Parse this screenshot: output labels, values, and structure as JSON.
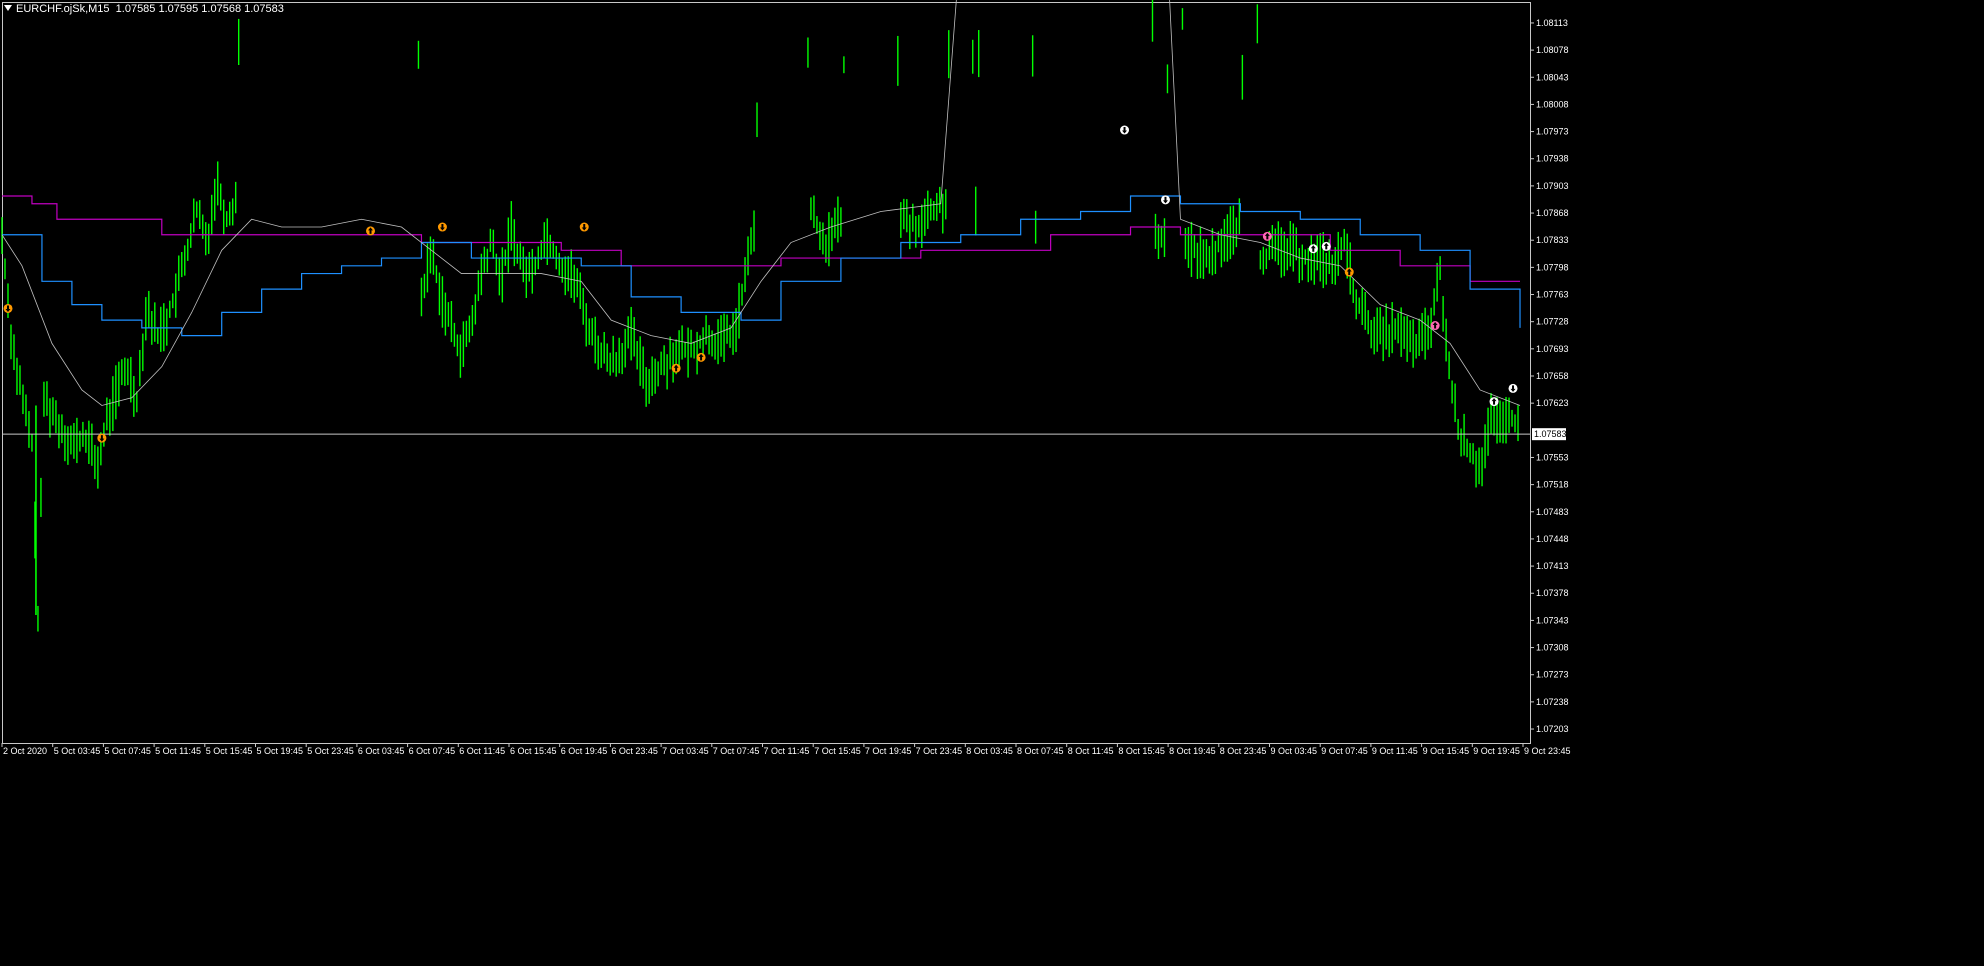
{
  "header": {
    "symbol_tf": "EURCHF.ojSk,M15",
    "ohlc": "1.07585 1.07595 1.07568 1.07583"
  },
  "colors": {
    "background": "#000000",
    "frame": "#c8c8c8",
    "bars": "#00ff00",
    "ma_slow": "#c000c0",
    "ma_mid": "#1e90ff",
    "ma_fast": "#c0c0c0",
    "price_line": "#c8c8c8",
    "signal_orange": "#ff9900",
    "signal_white": "#ffffff",
    "signal_pink": "#ff69b4"
  },
  "chart_data": {
    "type": "line",
    "title": "EURCHF.ojSk,M15",
    "ylim": [
      1.07185,
      1.0814
    ],
    "y_ticks": [
      "1.08113",
      "1.08078",
      "1.08043",
      "1.08008",
      "1.07973",
      "1.07938",
      "1.07903",
      "1.07868",
      "1.07833",
      "1.07798",
      "1.07763",
      "1.07728",
      "1.07693",
      "1.07658",
      "1.07623",
      "1.07553",
      "1.07518",
      "1.07483",
      "1.07448",
      "1.07413",
      "1.07378",
      "1.07343",
      "1.07308",
      "1.07273",
      "1.07238",
      "1.07203"
    ],
    "x_ticks": [
      "2 Oct 2020",
      "5 Oct 03:45",
      "5 Oct 07:45",
      "5 Oct 11:45",
      "5 Oct 15:45",
      "5 Oct 19:45",
      "5 Oct 23:45",
      "6 Oct 03:45",
      "6 Oct 07:45",
      "6 Oct 11:45",
      "6 Oct 15:45",
      "6 Oct 19:45",
      "6 Oct 23:45",
      "7 Oct 03:45",
      "7 Oct 07:45",
      "7 Oct 11:45",
      "7 Oct 15:45",
      "7 Oct 19:45",
      "7 Oct 23:45",
      "8 Oct 03:45",
      "8 Oct 07:45",
      "8 Oct 11:45",
      "8 Oct 15:45",
      "8 Oct 19:45",
      "8 Oct 23:45",
      "9 Oct 03:45",
      "9 Oct 07:45",
      "9 Oct 11:45",
      "9 Oct 15:45",
      "9 Oct 19:45",
      "9 Oct 23:45"
    ],
    "current_price": 1.07583,
    "current_price_label": "1.07583",
    "price_series": [
      [
        0,
        1.0784
      ],
      [
        10,
        1.077
      ],
      [
        20,
        1.0763
      ],
      [
        30,
        1.0757
      ],
      [
        36,
        1.0735
      ],
      [
        42,
        1.0763
      ],
      [
        55,
        1.076
      ],
      [
        70,
        1.0757
      ],
      [
        85,
        1.0758
      ],
      [
        95,
        1.0754
      ],
      [
        105,
        1.076
      ],
      [
        115,
        1.0764
      ],
      [
        125,
        1.0767
      ],
      [
        135,
        1.0763
      ],
      [
        145,
        1.0775
      ],
      [
        155,
        1.0771
      ],
      [
        165,
        1.0773
      ],
      [
        175,
        1.0777
      ],
      [
        185,
        1.0782
      ],
      [
        195,
        1.0787
      ],
      [
        205,
        1.0783
      ],
      [
        215,
        1.0791
      ],
      [
        225,
        1.0786
      ],
      [
        235,
        1.0789
      ],
      [
        245,
        1.0891
      ],
      [
        255,
        1.0886
      ],
      [
        265,
        1.0884
      ],
      [
        275,
        1.088
      ],
      [
        285,
        1.0882
      ],
      [
        295,
        1.088
      ],
      [
        305,
        1.0884
      ],
      [
        315,
        1.0883
      ],
      [
        325,
        1.0885
      ],
      [
        340,
        1.0885
      ],
      [
        355,
        1.0883
      ],
      [
        370,
        1.0882
      ],
      [
        385,
        1.0885
      ],
      [
        400,
        1.0884
      ],
      [
        410,
        1.088
      ],
      [
        420,
        1.0776
      ],
      [
        430,
        1.0782
      ],
      [
        440,
        1.0776
      ],
      [
        450,
        1.0772
      ],
      [
        460,
        1.0769
      ],
      [
        470,
        1.0772
      ],
      [
        480,
        1.0779
      ],
      [
        490,
        1.0783
      ],
      [
        500,
        1.0778
      ],
      [
        510,
        1.0785
      ],
      [
        520,
        1.078
      ],
      [
        530,
        1.0779
      ],
      [
        545,
        1.0784
      ],
      [
        560,
        1.078
      ],
      [
        575,
        1.0778
      ],
      [
        585,
        1.0773
      ],
      [
        595,
        1.077
      ],
      [
        605,
        1.0768
      ],
      [
        615,
        1.0768
      ],
      [
        630,
        1.0771
      ],
      [
        645,
        1.0765
      ],
      [
        660,
        1.0767
      ],
      [
        675,
        1.0769
      ],
      [
        690,
        1.0769
      ],
      [
        705,
        1.0771
      ],
      [
        720,
        1.077
      ],
      [
        735,
        1.0772
      ],
      [
        745,
        1.0779
      ],
      [
        755,
        1.0787
      ],
      [
        765,
        1.0891
      ],
      [
        775,
        1.0889
      ],
      [
        785,
        1.0891
      ],
      [
        795,
        1.0891
      ],
      [
        810,
        1.0787
      ],
      [
        825,
        1.0783
      ],
      [
        840,
        1.0786
      ],
      [
        855,
        1.0886
      ],
      [
        870,
        1.0887
      ],
      [
        885,
        1.0888
      ],
      [
        900,
        1.0786
      ],
      [
        915,
        1.0785
      ],
      [
        930,
        1.0787
      ],
      [
        945,
        1.0788
      ],
      [
        960,
        1.0886
      ],
      [
        975,
        1.0787
      ],
      [
        990,
        1.0888
      ],
      [
        1005,
        1.0889
      ],
      [
        1020,
        1.089
      ],
      [
        1035,
        1.0786
      ],
      [
        1045,
        1.0887
      ],
      [
        1055,
        1.0892
      ],
      [
        1065,
        1.0889
      ],
      [
        1075,
        1.0886
      ],
      [
        1085,
        1.0895
      ],
      [
        1095,
        1.0898
      ],
      [
        1105,
        1.0897
      ],
      [
        1115,
        1.0899
      ],
      [
        1125,
        1.0895
      ],
      [
        1135,
        1.0888
      ],
      [
        1145,
        1.0881
      ],
      [
        1155,
        1.0783
      ],
      [
        1165,
        1.0784
      ],
      [
        1175,
        1.0882
      ],
      [
        1185,
        1.0782
      ],
      [
        1195,
        1.0782
      ],
      [
        1210,
        1.0781
      ],
      [
        1225,
        1.0784
      ],
      [
        1240,
        1.0785
      ],
      [
        1250,
        1.0885
      ],
      [
        1260,
        1.0781
      ],
      [
        1275,
        1.0782
      ],
      [
        1290,
        1.0782
      ],
      [
        1305,
        1.0781
      ],
      [
        1320,
        1.0781
      ],
      [
        1335,
        1.078
      ],
      [
        1345,
        1.0783
      ],
      [
        1355,
        1.0776
      ],
      [
        1365,
        1.0773
      ],
      [
        1380,
        1.0771
      ],
      [
        1395,
        1.0772
      ],
      [
        1410,
        1.077
      ],
      [
        1420,
        1.077
      ],
      [
        1430,
        1.0772
      ],
      [
        1440,
        1.0779
      ],
      [
        1450,
        1.0765
      ],
      [
        1460,
        1.0758
      ],
      [
        1470,
        1.0756
      ],
      [
        1480,
        1.0754
      ],
      [
        1490,
        1.076
      ],
      [
        1500,
        1.0759
      ],
      [
        1510,
        1.0761
      ],
      [
        1520,
        1.0758
      ]
    ],
    "series": [
      {
        "values": [
          [
            0,
            1.0789
          ],
          [
            30,
            1.0788
          ],
          [
            55,
            1.0786
          ],
          [
            110,
            1.0786
          ],
          [
            160,
            1.0784
          ],
          [
            300,
            1.0784
          ],
          [
            420,
            1.0783
          ],
          [
            560,
            1.0782
          ],
          [
            620,
            1.078
          ],
          [
            750,
            1.078
          ],
          [
            780,
            1.0781
          ],
          [
            920,
            1.0782
          ],
          [
            1050,
            1.0784
          ],
          [
            1130,
            1.0785
          ],
          [
            1180,
            1.0784
          ],
          [
            1250,
            1.0784
          ],
          [
            1330,
            1.0782
          ],
          [
            1400,
            1.078
          ],
          [
            1470,
            1.0778
          ],
          [
            1520,
            1.0778
          ]
        ]
      },
      {
        "values": [
          [
            0,
            1.0784
          ],
          [
            40,
            1.0778
          ],
          [
            70,
            1.0775
          ],
          [
            100,
            1.0773
          ],
          [
            140,
            1.0772
          ],
          [
            180,
            1.0771
          ],
          [
            220,
            1.0774
          ],
          [
            260,
            1.0777
          ],
          [
            300,
            1.0779
          ],
          [
            340,
            1.078
          ],
          [
            380,
            1.0781
          ],
          [
            420,
            1.0783
          ],
          [
            470,
            1.0781
          ],
          [
            530,
            1.0781
          ],
          [
            580,
            1.078
          ],
          [
            630,
            1.0776
          ],
          [
            680,
            1.0774
          ],
          [
            740,
            1.0773
          ],
          [
            780,
            1.0778
          ],
          [
            840,
            1.0781
          ],
          [
            900,
            1.0783
          ],
          [
            960,
            1.0784
          ],
          [
            1020,
            1.0786
          ],
          [
            1080,
            1.0787
          ],
          [
            1130,
            1.0789
          ],
          [
            1180,
            1.0788
          ],
          [
            1240,
            1.0787
          ],
          [
            1300,
            1.0786
          ],
          [
            1360,
            1.0784
          ],
          [
            1420,
            1.0782
          ],
          [
            1470,
            1.0777
          ],
          [
            1520,
            1.0772
          ]
        ]
      },
      {
        "values": [
          [
            0,
            1.0784
          ],
          [
            20,
            1.078
          ],
          [
            50,
            1.077
          ],
          [
            80,
            1.0764
          ],
          [
            100,
            1.0762
          ],
          [
            130,
            1.0763
          ],
          [
            160,
            1.0767
          ],
          [
            190,
            1.0774
          ],
          [
            220,
            1.0782
          ],
          [
            250,
            1.0786
          ],
          [
            280,
            1.0785
          ],
          [
            320,
            1.0785
          ],
          [
            360,
            1.0786
          ],
          [
            400,
            1.0785
          ],
          [
            430,
            1.0782
          ],
          [
            460,
            1.0779
          ],
          [
            500,
            1.0779
          ],
          [
            540,
            1.0779
          ],
          [
            580,
            1.0778
          ],
          [
            610,
            1.0773
          ],
          [
            650,
            1.0771
          ],
          [
            690,
            1.077
          ],
          [
            730,
            1.0772
          ],
          [
            760,
            1.0778
          ],
          [
            790,
            1.0783
          ],
          [
            830,
            1.0785
          ],
          [
            880,
            1.0787
          ],
          [
            940,
            1.0788
          ],
          [
            1000,
            1.0889
          ],
          [
            1050,
            1.089
          ],
          [
            1080,
            1.0893
          ],
          [
            1110,
            1.0895
          ],
          [
            1140,
            1.089
          ],
          [
            1180,
            1.0786
          ],
          [
            1220,
            1.0784
          ],
          [
            1260,
            1.0783
          ],
          [
            1300,
            1.0781
          ],
          [
            1340,
            1.078
          ],
          [
            1380,
            1.0775
          ],
          [
            1420,
            1.0773
          ],
          [
            1450,
            1.077
          ],
          [
            1480,
            1.0764
          ],
          [
            1520,
            1.0762
          ]
        ]
      }
    ],
    "markers": [
      {
        "x": 6,
        "y": 1.07745,
        "color": "orange",
        "dir": "down"
      },
      {
        "x": 100,
        "y": 1.07578,
        "color": "orange",
        "dir": "down"
      },
      {
        "x": 369,
        "y": 1.07845,
        "color": "orange",
        "dir": "up"
      },
      {
        "x": 441,
        "y": 1.0785,
        "color": "orange",
        "dir": "down"
      },
      {
        "x": 583,
        "y": 1.0785,
        "color": "orange",
        "dir": "down"
      },
      {
        "x": 675,
        "y": 1.07668,
        "color": "orange",
        "dir": "up"
      },
      {
        "x": 700,
        "y": 1.07682,
        "color": "orange",
        "dir": "up"
      },
      {
        "x": 1124,
        "y": 1.07975,
        "color": "white",
        "dir": "down"
      },
      {
        "x": 1165,
        "y": 1.07885,
        "color": "white",
        "dir": "down"
      },
      {
        "x": 1267,
        "y": 1.07838,
        "color": "pink",
        "dir": "up"
      },
      {
        "x": 1313,
        "y": 1.07822,
        "color": "white",
        "dir": "up"
      },
      {
        "x": 1326,
        "y": 1.07825,
        "color": "white",
        "dir": "up"
      },
      {
        "x": 1349,
        "y": 1.07792,
        "color": "orange",
        "dir": "up"
      },
      {
        "x": 1435,
        "y": 1.07723,
        "color": "pink",
        "dir": "up"
      },
      {
        "x": 1494,
        "y": 1.07625,
        "color": "white",
        "dir": "up"
      },
      {
        "x": 1513,
        "y": 1.07642,
        "color": "white",
        "dir": "down"
      }
    ]
  }
}
